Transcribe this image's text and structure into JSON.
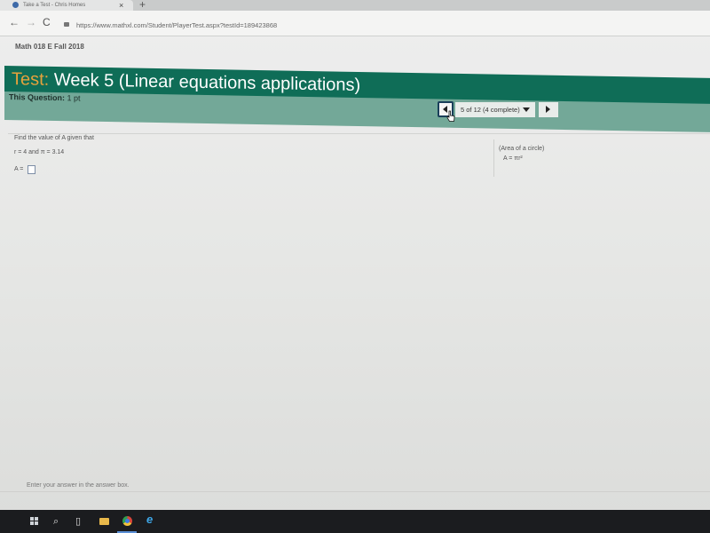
{
  "browser": {
    "tab_title": "Take a Test - Chris Homes",
    "close_glyph": "×",
    "new_tab_glyph": "+",
    "url": "https://www.mathxl.com/Student/PlayerTest.aspx?testId=189423868",
    "back_glyph": "←",
    "forward_glyph": "→",
    "reload_glyph": "C"
  },
  "course": {
    "name": "Math 018 E Fall 2018"
  },
  "test": {
    "prefix": "Test:",
    "title": "Week 5 (Linear equations applications)"
  },
  "question_info": {
    "label": "This Question:",
    "points": "1 pt",
    "progress": "5 of 12 (4 complete)"
  },
  "question": {
    "prompt": "Find the value of A given that",
    "given": "r = 4 and π = 3.14",
    "answer_label": "A =",
    "answer_value": "",
    "formula_note": "(Area of a circle)",
    "formula": "A = πr²"
  },
  "footer": {
    "hint": "Enter your answer in the answer box."
  },
  "taskbar": {
    "search_glyph": "⌕",
    "taskview_glyph": "▯",
    "ie_glyph": "e"
  }
}
